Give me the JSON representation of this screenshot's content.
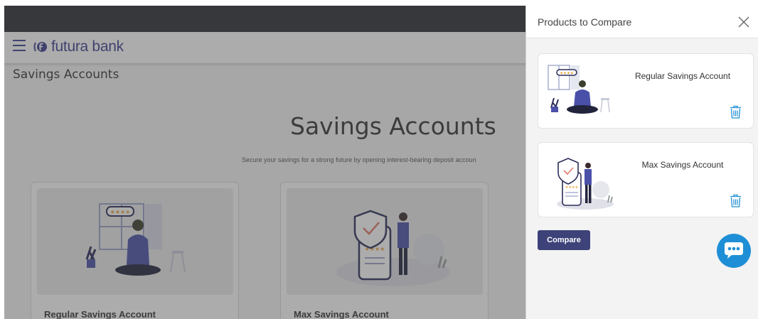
{
  "brand": {
    "name": "futura bank",
    "color": "#3b3f8f"
  },
  "page": {
    "title": "Savings Accounts",
    "hero_title": "Savings Accounts",
    "hero_subtitle": "Secure your savings for a strong future by opening interest-bearing deposit accoun"
  },
  "cards": [
    {
      "name": "Regular Savings Account",
      "illustration": "woman-on-phone-illustration"
    },
    {
      "name": "Max Savings Account",
      "illustration": "man-with-shield-illustration"
    }
  ],
  "compare_panel": {
    "title": "Products to Compare",
    "items": [
      {
        "name": "Regular Savings Account",
        "illustration": "woman-on-phone-illustration",
        "remove_icon": "trash-icon"
      },
      {
        "name": "Max Savings Account",
        "illustration": "man-with-shield-illustration",
        "remove_icon": "trash-icon"
      }
    ],
    "compare_label": "Compare",
    "accent": "#3d4279",
    "chat_color": "#1e8fd6"
  }
}
